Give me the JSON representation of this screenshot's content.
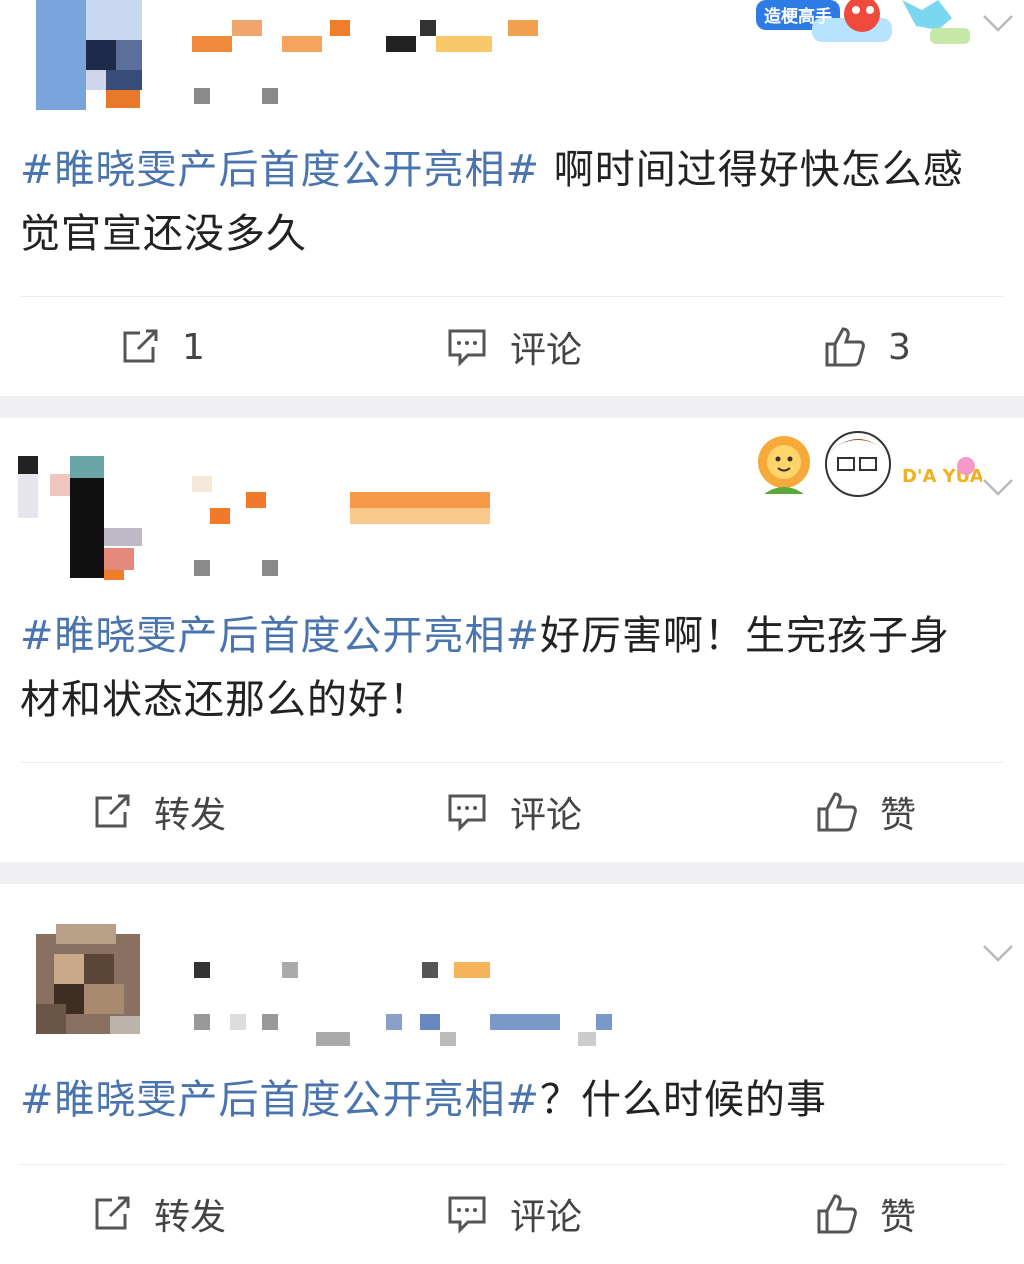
{
  "posts": [
    {
      "topic": "#睢晓雯产后首度公开亮相#",
      "body": " 啊时间过得好快怎么感觉官宣还没多久",
      "badge_text": "造梗高手",
      "actions": {
        "repost": "1",
        "comment": "评论",
        "like": "3"
      }
    },
    {
      "topic": "#睢晓雯产后首度公开亮相#",
      "body": "好厉害啊！生完孩子身材和状态还那么的好！",
      "badge_text": "D'A YUAN",
      "actions": {
        "repost": "转发",
        "comment": "评论",
        "like": "赞"
      }
    },
    {
      "topic": "#睢晓雯产后首度公开亮相#",
      "body": "？什么时候的事",
      "actions": {
        "repost": "转发",
        "comment": "评论",
        "like": "赞"
      }
    }
  ],
  "colors": {
    "topic": "#4a74ad",
    "text": "#222222",
    "separator": "#f0f0f2",
    "icon": "#555555"
  },
  "icons": [
    "repost-icon",
    "comment-icon",
    "like-icon",
    "chevron-down-icon"
  ]
}
